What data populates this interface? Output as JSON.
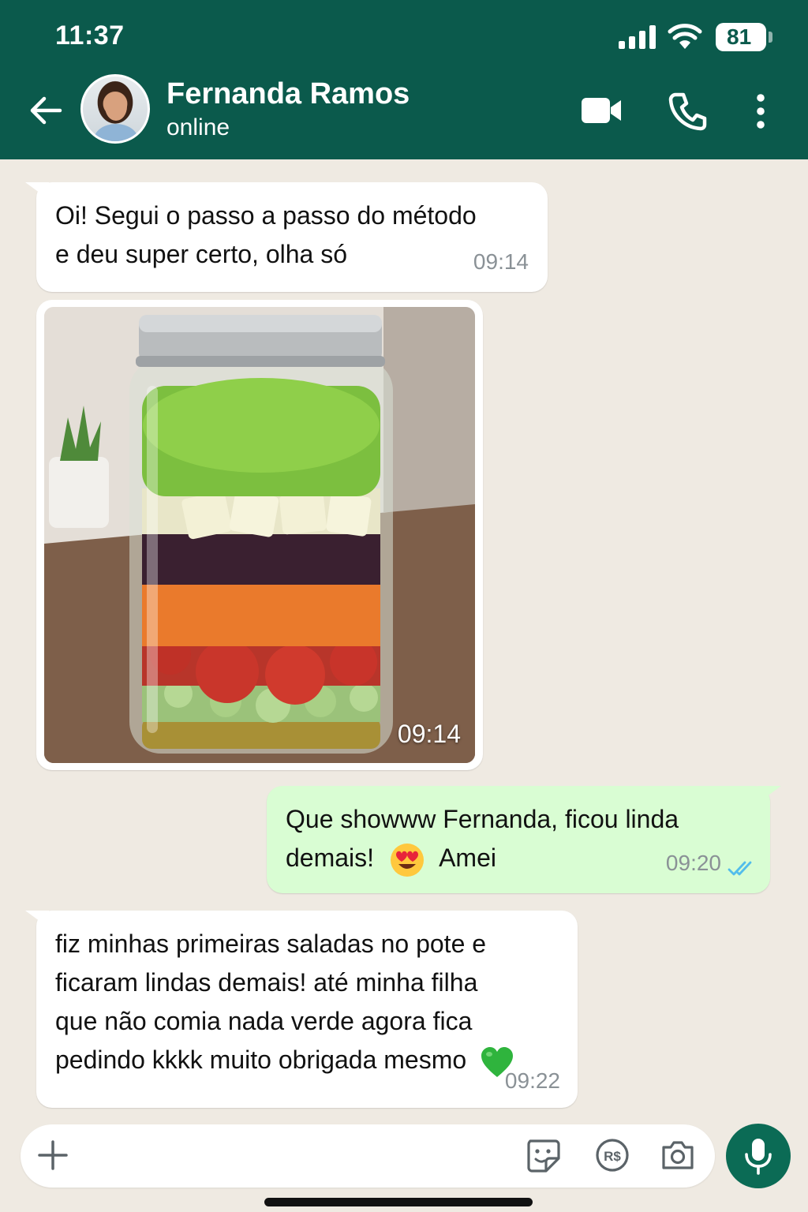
{
  "status_bar": {
    "time": "11:37",
    "battery": "81"
  },
  "header": {
    "contact_name": "Fernanda Ramos",
    "contact_status": "online"
  },
  "messages": [
    {
      "direction": "in",
      "text_lines": [
        "Oi! Segui o passo a passo do método",
        "e deu super certo, olha só"
      ],
      "time": "09:14"
    },
    {
      "direction": "in",
      "type": "image",
      "time": "09:14"
    },
    {
      "direction": "out",
      "text_line1": "Que showww Fernanda, ficou linda",
      "text_line2_before": "demais!",
      "text_line2_after": "Amei",
      "time": "09:20",
      "status": "read"
    },
    {
      "direction": "in",
      "text_lines": [
        "fiz minhas primeiras saladas no pote e",
        "ficaram lindas demais! até minha filha",
        "que não comia nada verde agora fica",
        "pedindo kkkk muito obrigada mesmo"
      ],
      "time": "09:22"
    }
  ],
  "colors": {
    "header": "#0b5a4c",
    "outgoing_bubble": "#d9fdd3",
    "read_ticks": "#53bdeb",
    "mic_button": "#0b6b55"
  },
  "icons": [
    "back-arrow-icon",
    "video-call-icon",
    "phone-icon",
    "more-vertical-icon",
    "plus-icon",
    "sticker-icon",
    "payment-icon",
    "camera-icon",
    "microphone-icon"
  ]
}
